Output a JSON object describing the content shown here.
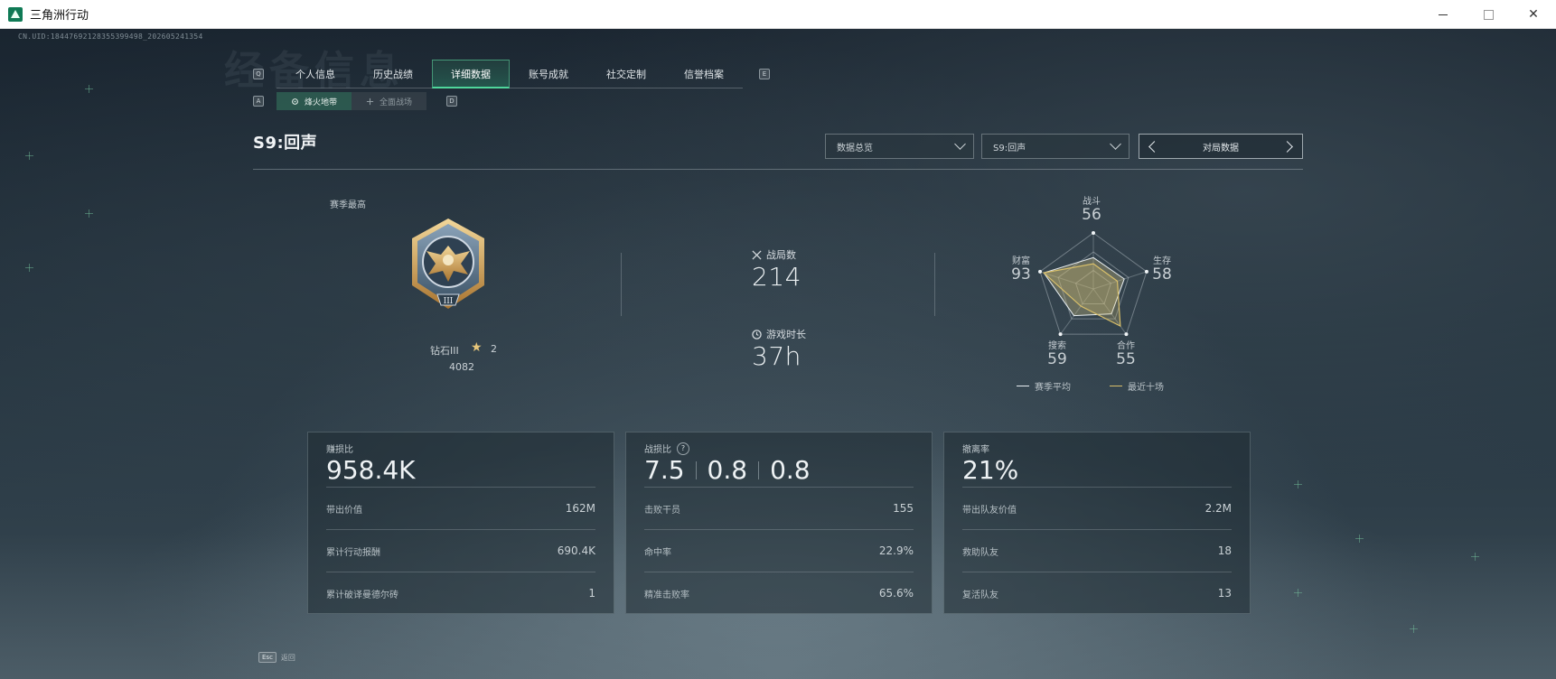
{
  "window": {
    "title": "三角洲行动"
  },
  "uid": "CN.UID:18447692128355399498_202605241354",
  "watermark": "经备信息",
  "keyhints": {
    "tab_prev": "Q",
    "tab_next": "E",
    "sub_prev": "A",
    "sub_next": "D"
  },
  "tabs": [
    {
      "label": "个人信息"
    },
    {
      "label": "历史战绩"
    },
    {
      "label": "详细数据",
      "active": true
    },
    {
      "label": "账号成就"
    },
    {
      "label": "社交定制"
    },
    {
      "label": "信誉档案"
    }
  ],
  "subtabs": [
    {
      "label": "烽火地带",
      "icon": "fire-zone-icon",
      "active": true
    },
    {
      "label": "全面战场",
      "icon": "battlefield-icon"
    }
  ],
  "header": {
    "season_title": "S9:回声",
    "dropdown_overview": "数据总览",
    "dropdown_season": "S9:回声",
    "pager_label": "对局数据"
  },
  "rank": {
    "label": "赛季最高",
    "name": "钻石III",
    "stars": "2",
    "score": "4082",
    "medal_numeral": "III"
  },
  "stats": {
    "matches_label": "战局数",
    "matches_value": "214",
    "playtime_label": "游戏时长",
    "playtime_value": "37h"
  },
  "radar": {
    "axes": [
      {
        "label": "战斗",
        "value": "56",
        "season": 56,
        "recent": 45
      },
      {
        "label": "生存",
        "value": "58",
        "season": 58,
        "recent": 45
      },
      {
        "label": "合作",
        "value": "55",
        "season": 55,
        "recent": 82
      },
      {
        "label": "搜索",
        "value": "59",
        "season": 59,
        "recent": 38
      },
      {
        "label": "财富",
        "value": "93",
        "season": 93,
        "recent": 93
      }
    ],
    "legend_season": "赛季平均",
    "legend_recent": "最近十场",
    "color_season": "#e8eef2",
    "color_recent": "#d8bf6a"
  },
  "cards": {
    "profit": {
      "title": "赚损比",
      "big": "958.4K",
      "rows": [
        {
          "label": "带出价值",
          "value": "162M"
        },
        {
          "label": "累计行动报酬",
          "value": "690.4K"
        },
        {
          "label": "累计破译曼德尔砖",
          "value": "1"
        }
      ]
    },
    "combat": {
      "title": "战损比",
      "help": "?",
      "big": [
        "7.5",
        "0.8",
        "0.8"
      ],
      "rows": [
        {
          "label": "击败干员",
          "value": "155"
        },
        {
          "label": "命中率",
          "value": "22.9%"
        },
        {
          "label": "精准击败率",
          "value": "65.6%"
        }
      ]
    },
    "extract": {
      "title": "撤离率",
      "big": "21%",
      "rows": [
        {
          "label": "带出队友价值",
          "value": "2.2M"
        },
        {
          "label": "救助队友",
          "value": "18"
        },
        {
          "label": "复活队友",
          "value": "13"
        }
      ]
    }
  },
  "footer": {
    "esc_key": "Esc",
    "esc_label": "返回"
  }
}
